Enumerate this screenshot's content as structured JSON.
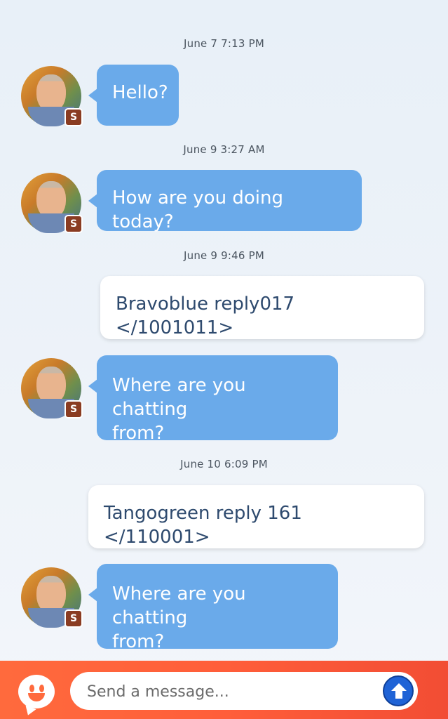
{
  "messages": [
    {
      "timestamp": "June 7 7:13 PM",
      "from": "them",
      "text": "Hello?"
    },
    {
      "timestamp": "June 9 3:27 AM",
      "from": "them",
      "text": "How are you doing today?"
    },
    {
      "timestamp": "June 9 9:46 PM",
      "from": "me",
      "text": "Bravoblue reply017 </1001011>"
    },
    {
      "timestamp": "",
      "from": "them",
      "text_lines": [
        "Where are you chatting",
        "from?"
      ]
    },
    {
      "timestamp": "June 10 6:09 PM",
      "from": "me",
      "text": "Tangogreen reply 161 </110001>"
    },
    {
      "timestamp": "",
      "from": "them",
      "text_lines": [
        "Where are you chatting",
        "from?"
      ]
    }
  ],
  "avatar_badge": "S",
  "composer": {
    "placeholder": "Send a message...",
    "emoji_icon": "smiley-chat-icon",
    "send_icon": "arrow-up-icon"
  },
  "colors": {
    "their_bubble": "#6aaaea",
    "my_bubble": "#ffffff",
    "my_text": "#2e4a6e",
    "footer": "#ff5e3a",
    "send_button": "#1f63d6"
  }
}
